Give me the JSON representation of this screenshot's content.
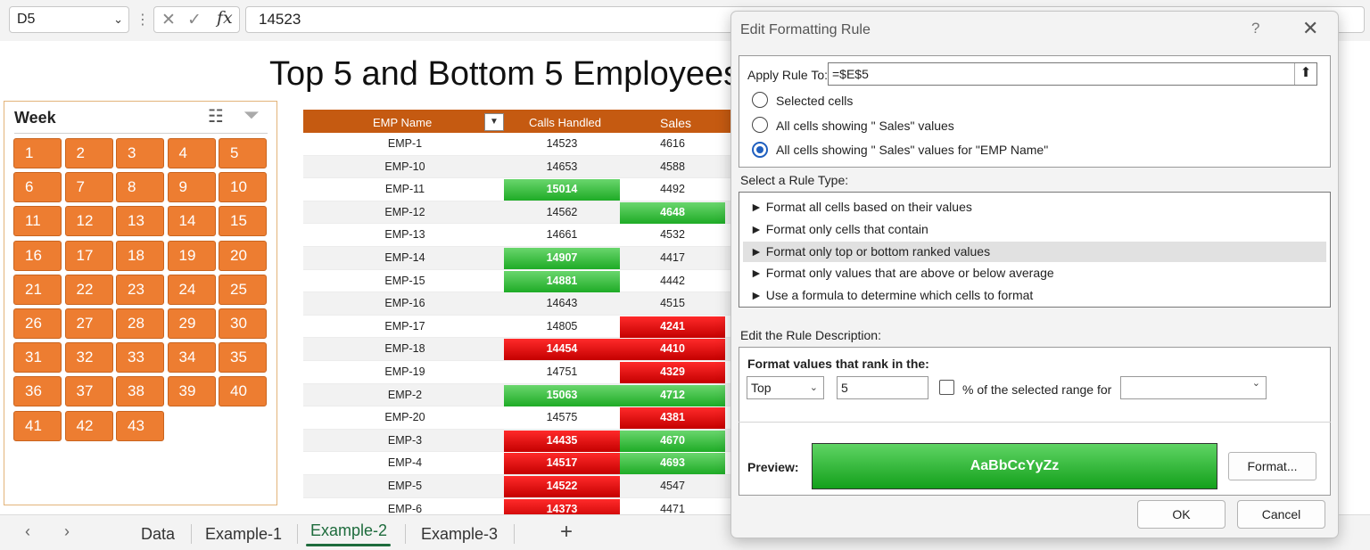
{
  "formula_bar": {
    "name_box": "D5",
    "formula_value": "14523",
    "cancel_glyph": "✕",
    "enter_glyph": "✓",
    "fx_label": "fx"
  },
  "sheet_title": "Top 5 and Bottom 5 Employees",
  "slicer": {
    "title": "Week",
    "buttons": [
      "1",
      "2",
      "3",
      "4",
      "5",
      "6",
      "7",
      "8",
      "9",
      "10",
      "11",
      "12",
      "13",
      "14",
      "15",
      "16",
      "17",
      "18",
      "19",
      "20",
      "21",
      "22",
      "23",
      "24",
      "25",
      "26",
      "27",
      "28",
      "29",
      "30",
      "31",
      "32",
      "33",
      "34",
      "35",
      "36",
      "37",
      "38",
      "39",
      "40",
      "41",
      "42",
      "43"
    ]
  },
  "table": {
    "headers": [
      "EMP Name",
      "Calls Handled",
      "Sales"
    ],
    "rows": [
      {
        "name": "EMP-1",
        "calls": "14523",
        "sales": "4616",
        "calls_hl": "",
        "sales_hl": ""
      },
      {
        "name": "EMP-10",
        "calls": "14653",
        "sales": "4588",
        "calls_hl": "",
        "sales_hl": ""
      },
      {
        "name": "EMP-11",
        "calls": "15014",
        "sales": "4492",
        "calls_hl": "green",
        "sales_hl": ""
      },
      {
        "name": "EMP-12",
        "calls": "14562",
        "sales": "4648",
        "calls_hl": "",
        "sales_hl": "green"
      },
      {
        "name": "EMP-13",
        "calls": "14661",
        "sales": "4532",
        "calls_hl": "",
        "sales_hl": ""
      },
      {
        "name": "EMP-14",
        "calls": "14907",
        "sales": "4417",
        "calls_hl": "green",
        "sales_hl": ""
      },
      {
        "name": "EMP-15",
        "calls": "14881",
        "sales": "4442",
        "calls_hl": "green",
        "sales_hl": ""
      },
      {
        "name": "EMP-16",
        "calls": "14643",
        "sales": "4515",
        "calls_hl": "",
        "sales_hl": ""
      },
      {
        "name": "EMP-17",
        "calls": "14805",
        "sales": "4241",
        "calls_hl": "",
        "sales_hl": "red"
      },
      {
        "name": "EMP-18",
        "calls": "14454",
        "sales": "4410",
        "calls_hl": "red",
        "sales_hl": "red"
      },
      {
        "name": "EMP-19",
        "calls": "14751",
        "sales": "4329",
        "calls_hl": "",
        "sales_hl": "red"
      },
      {
        "name": "EMP-2",
        "calls": "15063",
        "sales": "4712",
        "calls_hl": "green",
        "sales_hl": "green"
      },
      {
        "name": "EMP-20",
        "calls": "14575",
        "sales": "4381",
        "calls_hl": "",
        "sales_hl": "red"
      },
      {
        "name": "EMP-3",
        "calls": "14435",
        "sales": "4670",
        "calls_hl": "red",
        "sales_hl": "green"
      },
      {
        "name": "EMP-4",
        "calls": "14517",
        "sales": "4693",
        "calls_hl": "red",
        "sales_hl": "green"
      },
      {
        "name": "EMP-5",
        "calls": "14522",
        "sales": "4547",
        "calls_hl": "red",
        "sales_hl": ""
      },
      {
        "name": "EMP-6",
        "calls": "14373",
        "sales": "4471",
        "calls_hl": "red",
        "sales_hl": ""
      }
    ]
  },
  "sheet_tabs": {
    "tabs": [
      "Data",
      "Example-1",
      "Example-2",
      "Example-3"
    ],
    "active": "Example-2",
    "add_glyph": "+"
  },
  "dialog": {
    "title": "Edit Formatting Rule",
    "help_glyph": "?",
    "close_glyph": "✕",
    "apply_rule_label": "Apply Rule To:",
    "apply_rule_value": "=$E$5",
    "radio_options": [
      {
        "label": "Selected cells",
        "checked": false
      },
      {
        "label": "All cells showing \" Sales\" values",
        "checked": false
      },
      {
        "label": "All cells showing \" Sales\" values for \"EMP Name\"",
        "checked": true
      }
    ],
    "rule_type_label": "Select a Rule Type:",
    "rule_types": [
      "► Format all cells based on their values",
      "► Format only cells that contain",
      "► Format only top or bottom ranked values",
      "► Format only values that are above or below average",
      "► Use a formula to determine which cells to format"
    ],
    "selected_rule_index": 2,
    "edit_desc_label": "Edit the Rule Description:",
    "rank_label": "Format values that rank in the:",
    "rank_select": "Top",
    "rank_number": "5",
    "percent_label": "% of the selected range for",
    "percent_checked": false,
    "range_for_value": "",
    "preview_label": "Preview:",
    "preview_text": "AaBbCcYyZz",
    "format_button": "Format...",
    "ok_button": "OK",
    "cancel_button": "Cancel"
  },
  "colors": {
    "slicer_button": "#ed7d31",
    "header_fill": "#c55a11",
    "top_green": "#1eab26",
    "bottom_red": "#d40000",
    "active_tab": "#1d6b3c"
  }
}
